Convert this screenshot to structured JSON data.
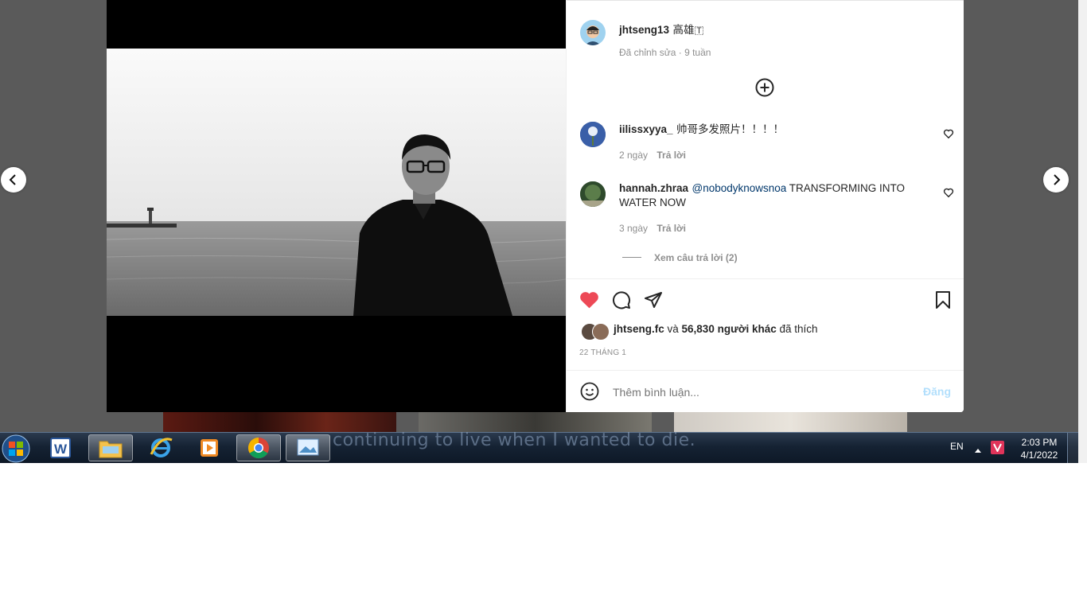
{
  "post": {
    "author": "jhtseng13",
    "location": "高雄🇹",
    "meta": "Đã chỉnh sửa · 9 tuần"
  },
  "comments": [
    {
      "user": "iilissxyya_",
      "mention": "",
      "text": "帅哥多发照片！！！！",
      "age": "2 ngày",
      "reply": "Trả lời"
    },
    {
      "user": "hannah.zhraa",
      "mention": "@nobodyknowsnoa",
      "text": " TRANSFORMING INTO WATER NOW",
      "age": "3 ngày",
      "reply": "Trả lời"
    }
  ],
  "view_replies": "Xem câu trả lời (2)",
  "likes": {
    "user": "jhtseng.fc",
    "and": " và ",
    "count": "56,830 người khác",
    "suffix": " đã thích"
  },
  "date": "22 THÁNG 1",
  "comment_box": {
    "placeholder": "Thêm bình luận...",
    "post_label": "Đăng"
  },
  "taskbar": {
    "lang": "EN",
    "time": "2:03 PM",
    "date": "4/1/2022",
    "caption": "continuing to live when I wanted to die."
  },
  "colors": {
    "like_red": "#ed4956",
    "post_disabled": "#b2dffc",
    "link": "#00376b"
  }
}
